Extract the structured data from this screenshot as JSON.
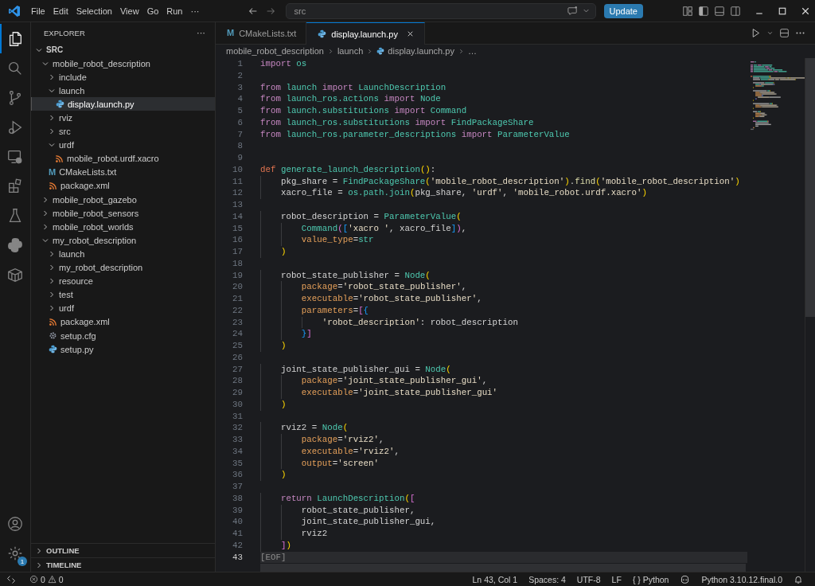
{
  "titlebar": {
    "menus": [
      "File",
      "Edit",
      "Selection",
      "View",
      "Go",
      "Run",
      "···"
    ],
    "search": {
      "value": "src"
    },
    "update_button": "Update"
  },
  "activity_bar": {
    "items": [
      {
        "kind": "explorer",
        "selected": true
      },
      {
        "kind": "search",
        "selected": false
      },
      {
        "kind": "source-control",
        "selected": false
      },
      {
        "kind": "run-debug",
        "selected": false
      },
      {
        "kind": "remote",
        "selected": false
      },
      {
        "kind": "extensions",
        "selected": false
      },
      {
        "kind": "testing",
        "selected": false
      },
      {
        "kind": "python",
        "selected": false
      },
      {
        "kind": "container",
        "selected": false
      }
    ],
    "settings_badge": "1"
  },
  "sidebar": {
    "title": "EXPLORER",
    "more": "···",
    "tree": [
      {
        "label": "SRC",
        "kind": "root",
        "expanded": true,
        "selected": false,
        "children": [
          {
            "label": "mobile_robot_description",
            "kind": "folder",
            "expanded": true,
            "selected": false,
            "children": [
              {
                "label": "include",
                "kind": "folder",
                "expanded": false,
                "selected": false
              },
              {
                "label": "launch",
                "kind": "folder",
                "expanded": true,
                "selected": false,
                "children": [
                  {
                    "label": "display.launch.py",
                    "kind": "python",
                    "selected": true
                  }
                ]
              },
              {
                "label": "rviz",
                "kind": "folder",
                "expanded": false,
                "selected": false
              },
              {
                "label": "src",
                "kind": "folder",
                "expanded": false,
                "selected": false
              },
              {
                "label": "urdf",
                "kind": "folder",
                "expanded": true,
                "selected": false,
                "children": [
                  {
                    "label": "mobile_robot.urdf.xacro",
                    "kind": "xml",
                    "selected": false
                  }
                ]
              },
              {
                "label": "CMakeLists.txt",
                "kind": "cmake",
                "glyph": "M",
                "selected": false
              },
              {
                "label": "package.xml",
                "kind": "xml",
                "selected": false
              }
            ]
          },
          {
            "label": "mobile_robot_gazebo",
            "kind": "folder",
            "expanded": false,
            "selected": false
          },
          {
            "label": "mobile_robot_sensors",
            "kind": "folder",
            "expanded": false,
            "selected": false
          },
          {
            "label": "mobile_robot_worlds",
            "kind": "folder",
            "expanded": false,
            "selected": false
          },
          {
            "label": "my_robot_description",
            "kind": "folder",
            "expanded": true,
            "selected": false,
            "children": [
              {
                "label": "launch",
                "kind": "folder",
                "expanded": false,
                "selected": false
              },
              {
                "label": "my_robot_description",
                "kind": "folder",
                "expanded": false,
                "selected": false
              },
              {
                "label": "resource",
                "kind": "folder",
                "expanded": false,
                "selected": false
              },
              {
                "label": "test",
                "kind": "folder",
                "expanded": false,
                "selected": false
              },
              {
                "label": "urdf",
                "kind": "folder",
                "expanded": false,
                "selected": false
              },
              {
                "label": "package.xml",
                "kind": "xml",
                "selected": false
              },
              {
                "label": "setup.cfg",
                "kind": "config",
                "selected": false
              },
              {
                "label": "setup.py",
                "kind": "python",
                "selected": false
              }
            ]
          }
        ]
      }
    ],
    "sections": [
      {
        "label": "OUTLINE",
        "expanded": false
      },
      {
        "label": "TIMELINE",
        "expanded": false
      }
    ]
  },
  "tabs": [
    {
      "label": "CMakeLists.txt",
      "kind": "cmake",
      "glyph": "M",
      "selected": false
    },
    {
      "label": "display.launch.py",
      "kind": "python",
      "selected": true
    }
  ],
  "breadcrumbs": [
    {
      "label": "mobile_robot_description",
      "kind": "folder"
    },
    {
      "label": "launch",
      "kind": "folder"
    },
    {
      "label": "display.launch.py",
      "kind": "python"
    },
    {
      "label": "…",
      "kind": "symbol"
    }
  ],
  "editor": {
    "lines": [
      {
        "n": "1",
        "current": false,
        "tokens": [
          {
            "kind": "kw",
            "text": "import "
          },
          {
            "kind": "type",
            "text": "os"
          }
        ]
      },
      {
        "n": "2",
        "current": false
      },
      {
        "n": "3",
        "current": false,
        "tokens": [
          {
            "kind": "kw",
            "text": "from "
          },
          {
            "kind": "type",
            "text": "launch "
          },
          {
            "kind": "kw",
            "text": "import "
          },
          {
            "kind": "type",
            "text": "LaunchDescription"
          }
        ]
      },
      {
        "n": "4",
        "current": false,
        "tokens": [
          {
            "kind": "kw",
            "text": "from "
          },
          {
            "kind": "type",
            "text": "launch_ros.actions "
          },
          {
            "kind": "kw",
            "text": "import "
          },
          {
            "kind": "type",
            "text": "Node"
          }
        ]
      },
      {
        "n": "5",
        "current": false,
        "tokens": [
          {
            "kind": "kw",
            "text": "from "
          },
          {
            "kind": "type",
            "text": "launch.substitutions "
          },
          {
            "kind": "kw",
            "text": "import "
          },
          {
            "kind": "type",
            "text": "Command"
          }
        ]
      },
      {
        "n": "6",
        "current": false,
        "tokens": [
          {
            "kind": "kw",
            "text": "from "
          },
          {
            "kind": "type",
            "text": "launch_ros.substitutions "
          },
          {
            "kind": "kw",
            "text": "import "
          },
          {
            "kind": "type",
            "text": "FindPackageShare"
          }
        ]
      },
      {
        "n": "7",
        "current": false,
        "tokens": [
          {
            "kind": "kw",
            "text": "from "
          },
          {
            "kind": "type",
            "text": "launch_ros.parameter_descriptions "
          },
          {
            "kind": "kw",
            "text": "import "
          },
          {
            "kind": "type",
            "text": "ParameterValue"
          }
        ]
      },
      {
        "n": "8",
        "current": false
      },
      {
        "n": "9",
        "current": false
      },
      {
        "n": "10",
        "current": false,
        "tokens": [
          {
            "kind": "storage",
            "text": "def "
          },
          {
            "kind": "type",
            "text": "generate_launch_description"
          },
          {
            "kind": "b1",
            "text": "()"
          },
          {
            "kind": "plain",
            "text": ":"
          }
        ]
      },
      {
        "n": "11",
        "current": false,
        "tokens": [
          {
            "kind": "plain",
            "text": "    pkg_share = "
          },
          {
            "kind": "type",
            "text": "FindPackageShare"
          },
          {
            "kind": "b1",
            "text": "("
          },
          {
            "kind": "str",
            "text": "'mobile_robot_description'"
          },
          {
            "kind": "b1",
            "text": ")"
          },
          {
            "kind": "plain",
            "text": "."
          },
          {
            "kind": "func",
            "text": "find"
          },
          {
            "kind": "b1",
            "text": "("
          },
          {
            "kind": "str",
            "text": "'mobile_robot_description'"
          },
          {
            "kind": "b1",
            "text": ")"
          }
        ]
      },
      {
        "n": "12",
        "current": false,
        "tokens": [
          {
            "kind": "plain",
            "text": "    xacro_file = "
          },
          {
            "kind": "type",
            "text": "os.path.join"
          },
          {
            "kind": "b1",
            "text": "("
          },
          {
            "kind": "plain",
            "text": "pkg_share, "
          },
          {
            "kind": "str",
            "text": "'urdf'"
          },
          {
            "kind": "plain",
            "text": ", "
          },
          {
            "kind": "str",
            "text": "'mobile_robot.urdf.xacro'"
          },
          {
            "kind": "b1",
            "text": ")"
          }
        ]
      },
      {
        "n": "13",
        "current": false
      },
      {
        "n": "14",
        "current": false,
        "tokens": [
          {
            "kind": "plain",
            "text": "    robot_description = "
          },
          {
            "kind": "type",
            "text": "ParameterValue"
          },
          {
            "kind": "b1",
            "text": "("
          }
        ]
      },
      {
        "n": "15",
        "current": false,
        "tokens": [
          {
            "kind": "type",
            "text": "        Command"
          },
          {
            "kind": "b2",
            "text": "("
          },
          {
            "kind": "b3",
            "text": "["
          },
          {
            "kind": "str",
            "text": "'xacro '"
          },
          {
            "kind": "plain",
            "text": ", xacro_file"
          },
          {
            "kind": "b3",
            "text": "]"
          },
          {
            "kind": "b2",
            "text": ")"
          },
          {
            "kind": "plain",
            "text": ","
          }
        ]
      },
      {
        "n": "16",
        "current": false,
        "tokens": [
          {
            "kind": "param",
            "text": "        value_type"
          },
          {
            "kind": "plain",
            "text": "="
          },
          {
            "kind": "type",
            "text": "str"
          }
        ]
      },
      {
        "n": "17",
        "current": false,
        "tokens": [
          {
            "kind": "b1",
            "text": "    )"
          }
        ]
      },
      {
        "n": "18",
        "current": false
      },
      {
        "n": "19",
        "current": false,
        "tokens": [
          {
            "kind": "plain",
            "text": "    robot_state_publisher = "
          },
          {
            "kind": "type",
            "text": "Node"
          },
          {
            "kind": "b1",
            "text": "("
          }
        ]
      },
      {
        "n": "20",
        "current": false,
        "tokens": [
          {
            "kind": "param",
            "text": "        package"
          },
          {
            "kind": "plain",
            "text": "="
          },
          {
            "kind": "str",
            "text": "'robot_state_publisher'"
          },
          {
            "kind": "plain",
            "text": ","
          }
        ]
      },
      {
        "n": "21",
        "current": false,
        "tokens": [
          {
            "kind": "param",
            "text": "        executable"
          },
          {
            "kind": "plain",
            "text": "="
          },
          {
            "kind": "str",
            "text": "'robot_state_publisher'"
          },
          {
            "kind": "plain",
            "text": ","
          }
        ]
      },
      {
        "n": "22",
        "current": false,
        "tokens": [
          {
            "kind": "param",
            "text": "        parameters"
          },
          {
            "kind": "plain",
            "text": "="
          },
          {
            "kind": "b2",
            "text": "["
          },
          {
            "kind": "b3",
            "text": "{"
          }
        ]
      },
      {
        "n": "23",
        "current": false,
        "tokens": [
          {
            "kind": "str",
            "text": "            'robot_description'"
          },
          {
            "kind": "plain",
            "text": ": robot_description"
          }
        ]
      },
      {
        "n": "24",
        "current": false,
        "tokens": [
          {
            "kind": "b3",
            "text": "        }"
          },
          {
            "kind": "b2",
            "text": "]"
          }
        ]
      },
      {
        "n": "25",
        "current": false,
        "tokens": [
          {
            "kind": "b1",
            "text": "    )"
          }
        ]
      },
      {
        "n": "26",
        "current": false
      },
      {
        "n": "27",
        "current": false,
        "tokens": [
          {
            "kind": "plain",
            "text": "    joint_state_publisher_gui = "
          },
          {
            "kind": "type",
            "text": "Node"
          },
          {
            "kind": "b1",
            "text": "("
          }
        ]
      },
      {
        "n": "28",
        "current": false,
        "tokens": [
          {
            "kind": "param",
            "text": "        package"
          },
          {
            "kind": "plain",
            "text": "="
          },
          {
            "kind": "str",
            "text": "'joint_state_publisher_gui'"
          },
          {
            "kind": "plain",
            "text": ","
          }
        ]
      },
      {
        "n": "29",
        "current": false,
        "tokens": [
          {
            "kind": "param",
            "text": "        executable"
          },
          {
            "kind": "plain",
            "text": "="
          },
          {
            "kind": "str",
            "text": "'joint_state_publisher_gui'"
          }
        ]
      },
      {
        "n": "30",
        "current": false,
        "tokens": [
          {
            "kind": "b1",
            "text": "    )"
          }
        ]
      },
      {
        "n": "31",
        "current": false
      },
      {
        "n": "32",
        "current": false,
        "tokens": [
          {
            "kind": "plain",
            "text": "    rviz2 = "
          },
          {
            "kind": "type",
            "text": "Node"
          },
          {
            "kind": "b1",
            "text": "("
          }
        ]
      },
      {
        "n": "33",
        "current": false,
        "tokens": [
          {
            "kind": "param",
            "text": "        package"
          },
          {
            "kind": "plain",
            "text": "="
          },
          {
            "kind": "str",
            "text": "'rviz2'"
          },
          {
            "kind": "plain",
            "text": ","
          }
        ]
      },
      {
        "n": "34",
        "current": false,
        "tokens": [
          {
            "kind": "param",
            "text": "        executable"
          },
          {
            "kind": "plain",
            "text": "="
          },
          {
            "kind": "str",
            "text": "'rviz2'"
          },
          {
            "kind": "plain",
            "text": ","
          }
        ]
      },
      {
        "n": "35",
        "current": false,
        "tokens": [
          {
            "kind": "param",
            "text": "        output"
          },
          {
            "kind": "plain",
            "text": "="
          },
          {
            "kind": "str",
            "text": "'screen'"
          }
        ]
      },
      {
        "n": "36",
        "current": false,
        "tokens": [
          {
            "kind": "b1",
            "text": "    )"
          }
        ]
      },
      {
        "n": "37",
        "current": false
      },
      {
        "n": "38",
        "current": false,
        "tokens": [
          {
            "kind": "kw",
            "text": "    return "
          },
          {
            "kind": "type",
            "text": "LaunchDescription"
          },
          {
            "kind": "b1",
            "text": "("
          },
          {
            "kind": "b2",
            "text": "["
          }
        ]
      },
      {
        "n": "39",
        "current": false,
        "tokens": [
          {
            "kind": "plain",
            "text": "        robot_state_publisher,"
          }
        ]
      },
      {
        "n": "40",
        "current": false,
        "tokens": [
          {
            "kind": "plain",
            "text": "        joint_state_publisher_gui,"
          }
        ]
      },
      {
        "n": "41",
        "current": false,
        "tokens": [
          {
            "kind": "plain",
            "text": "        rviz2"
          }
        ]
      },
      {
        "n": "42",
        "current": false,
        "tokens": [
          {
            "kind": "b2",
            "text": "    ]"
          },
          {
            "kind": "b1",
            "text": ")"
          }
        ]
      },
      {
        "n": "43",
        "current": true,
        "tokens": [
          {
            "kind": "eof",
            "text": "[EOF]"
          }
        ]
      }
    ]
  },
  "status_bar": {
    "errors": "0",
    "warnings": "0",
    "right": [
      {
        "kind": "text",
        "text": "Ln 43, Col 1"
      },
      {
        "kind": "text",
        "text": "Spaces: 4"
      },
      {
        "kind": "text",
        "text": "UTF-8"
      },
      {
        "kind": "text",
        "text": "LF"
      },
      {
        "kind": "language",
        "glyph": "{ }",
        "text": "Python"
      },
      {
        "kind": "copilot"
      },
      {
        "kind": "text",
        "text": "Python 3.10.12.final.0"
      },
      {
        "kind": "bell"
      }
    ]
  }
}
